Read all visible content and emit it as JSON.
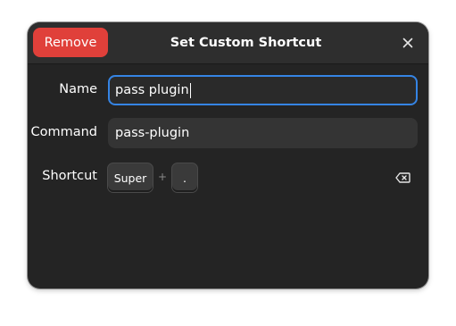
{
  "header": {
    "title": "Set Custom Shortcut",
    "remove_label": "Remove",
    "close_icon": "close-icon"
  },
  "form": {
    "name": {
      "label": "Name",
      "value": "pass plugin"
    },
    "command": {
      "label": "Command",
      "value": "pass-plugin"
    },
    "shortcut": {
      "label": "Shortcut",
      "keys": [
        "Super",
        "."
      ],
      "separator": "+",
      "clear_icon": "backspace-icon"
    }
  },
  "colors": {
    "destructive": "#e0403a",
    "focus_ring": "#3584e4",
    "dialog_bg": "#242424"
  }
}
